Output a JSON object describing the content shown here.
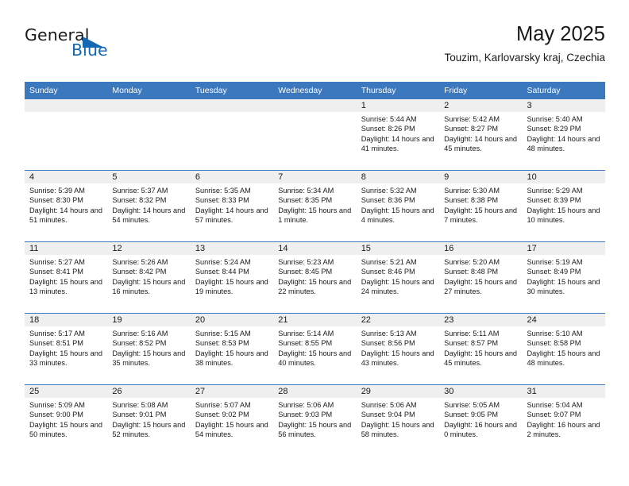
{
  "logo": {
    "word1": "General",
    "word2": "Blue",
    "accent_color": "#1268b3"
  },
  "header": {
    "title": "May 2025",
    "subtitle": "Touzim, Karlovarsky kraj, Czechia"
  },
  "colors": {
    "header_band": "#3b78bd",
    "day_band": "#efefef",
    "text": "#1a1a1a"
  },
  "calendar": {
    "weekday_headers": [
      "Sunday",
      "Monday",
      "Tuesday",
      "Wednesday",
      "Thursday",
      "Friday",
      "Saturday"
    ],
    "weeks": [
      [
        {
          "day": "",
          "empty": true
        },
        {
          "day": "",
          "empty": true
        },
        {
          "day": "",
          "empty": true
        },
        {
          "day": "",
          "empty": true
        },
        {
          "day": "1",
          "sunrise": "Sunrise: 5:44 AM",
          "sunset": "Sunset: 8:26 PM",
          "daylight": "Daylight: 14 hours and 41 minutes."
        },
        {
          "day": "2",
          "sunrise": "Sunrise: 5:42 AM",
          "sunset": "Sunset: 8:27 PM",
          "daylight": "Daylight: 14 hours and 45 minutes."
        },
        {
          "day": "3",
          "sunrise": "Sunrise: 5:40 AM",
          "sunset": "Sunset: 8:29 PM",
          "daylight": "Daylight: 14 hours and 48 minutes."
        }
      ],
      [
        {
          "day": "4",
          "sunrise": "Sunrise: 5:39 AM",
          "sunset": "Sunset: 8:30 PM",
          "daylight": "Daylight: 14 hours and 51 minutes."
        },
        {
          "day": "5",
          "sunrise": "Sunrise: 5:37 AM",
          "sunset": "Sunset: 8:32 PM",
          "daylight": "Daylight: 14 hours and 54 minutes."
        },
        {
          "day": "6",
          "sunrise": "Sunrise: 5:35 AM",
          "sunset": "Sunset: 8:33 PM",
          "daylight": "Daylight: 14 hours and 57 minutes."
        },
        {
          "day": "7",
          "sunrise": "Sunrise: 5:34 AM",
          "sunset": "Sunset: 8:35 PM",
          "daylight": "Daylight: 15 hours and 1 minute."
        },
        {
          "day": "8",
          "sunrise": "Sunrise: 5:32 AM",
          "sunset": "Sunset: 8:36 PM",
          "daylight": "Daylight: 15 hours and 4 minutes."
        },
        {
          "day": "9",
          "sunrise": "Sunrise: 5:30 AM",
          "sunset": "Sunset: 8:38 PM",
          "daylight": "Daylight: 15 hours and 7 minutes."
        },
        {
          "day": "10",
          "sunrise": "Sunrise: 5:29 AM",
          "sunset": "Sunset: 8:39 PM",
          "daylight": "Daylight: 15 hours and 10 minutes."
        }
      ],
      [
        {
          "day": "11",
          "sunrise": "Sunrise: 5:27 AM",
          "sunset": "Sunset: 8:41 PM",
          "daylight": "Daylight: 15 hours and 13 minutes."
        },
        {
          "day": "12",
          "sunrise": "Sunrise: 5:26 AM",
          "sunset": "Sunset: 8:42 PM",
          "daylight": "Daylight: 15 hours and 16 minutes."
        },
        {
          "day": "13",
          "sunrise": "Sunrise: 5:24 AM",
          "sunset": "Sunset: 8:44 PM",
          "daylight": "Daylight: 15 hours and 19 minutes."
        },
        {
          "day": "14",
          "sunrise": "Sunrise: 5:23 AM",
          "sunset": "Sunset: 8:45 PM",
          "daylight": "Daylight: 15 hours and 22 minutes."
        },
        {
          "day": "15",
          "sunrise": "Sunrise: 5:21 AM",
          "sunset": "Sunset: 8:46 PM",
          "daylight": "Daylight: 15 hours and 24 minutes."
        },
        {
          "day": "16",
          "sunrise": "Sunrise: 5:20 AM",
          "sunset": "Sunset: 8:48 PM",
          "daylight": "Daylight: 15 hours and 27 minutes."
        },
        {
          "day": "17",
          "sunrise": "Sunrise: 5:19 AM",
          "sunset": "Sunset: 8:49 PM",
          "daylight": "Daylight: 15 hours and 30 minutes."
        }
      ],
      [
        {
          "day": "18",
          "sunrise": "Sunrise: 5:17 AM",
          "sunset": "Sunset: 8:51 PM",
          "daylight": "Daylight: 15 hours and 33 minutes."
        },
        {
          "day": "19",
          "sunrise": "Sunrise: 5:16 AM",
          "sunset": "Sunset: 8:52 PM",
          "daylight": "Daylight: 15 hours and 35 minutes."
        },
        {
          "day": "20",
          "sunrise": "Sunrise: 5:15 AM",
          "sunset": "Sunset: 8:53 PM",
          "daylight": "Daylight: 15 hours and 38 minutes."
        },
        {
          "day": "21",
          "sunrise": "Sunrise: 5:14 AM",
          "sunset": "Sunset: 8:55 PM",
          "daylight": "Daylight: 15 hours and 40 minutes."
        },
        {
          "day": "22",
          "sunrise": "Sunrise: 5:13 AM",
          "sunset": "Sunset: 8:56 PM",
          "daylight": "Daylight: 15 hours and 43 minutes."
        },
        {
          "day": "23",
          "sunrise": "Sunrise: 5:11 AM",
          "sunset": "Sunset: 8:57 PM",
          "daylight": "Daylight: 15 hours and 45 minutes."
        },
        {
          "day": "24",
          "sunrise": "Sunrise: 5:10 AM",
          "sunset": "Sunset: 8:58 PM",
          "daylight": "Daylight: 15 hours and 48 minutes."
        }
      ],
      [
        {
          "day": "25",
          "sunrise": "Sunrise: 5:09 AM",
          "sunset": "Sunset: 9:00 PM",
          "daylight": "Daylight: 15 hours and 50 minutes."
        },
        {
          "day": "26",
          "sunrise": "Sunrise: 5:08 AM",
          "sunset": "Sunset: 9:01 PM",
          "daylight": "Daylight: 15 hours and 52 minutes."
        },
        {
          "day": "27",
          "sunrise": "Sunrise: 5:07 AM",
          "sunset": "Sunset: 9:02 PM",
          "daylight": "Daylight: 15 hours and 54 minutes."
        },
        {
          "day": "28",
          "sunrise": "Sunrise: 5:06 AM",
          "sunset": "Sunset: 9:03 PM",
          "daylight": "Daylight: 15 hours and 56 minutes."
        },
        {
          "day": "29",
          "sunrise": "Sunrise: 5:06 AM",
          "sunset": "Sunset: 9:04 PM",
          "daylight": "Daylight: 15 hours and 58 minutes."
        },
        {
          "day": "30",
          "sunrise": "Sunrise: 5:05 AM",
          "sunset": "Sunset: 9:05 PM",
          "daylight": "Daylight: 16 hours and 0 minutes."
        },
        {
          "day": "31",
          "sunrise": "Sunrise: 5:04 AM",
          "sunset": "Sunset: 9:07 PM",
          "daylight": "Daylight: 16 hours and 2 minutes."
        }
      ]
    ]
  }
}
